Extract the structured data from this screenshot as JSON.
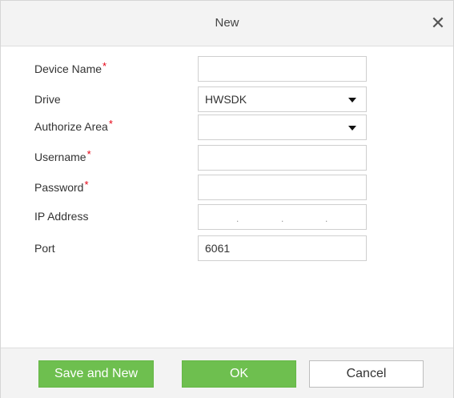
{
  "dialog": {
    "title": "New",
    "close_symbol": "✕",
    "close_icon": "close-icon"
  },
  "form": {
    "device_name": {
      "label": "Device Name",
      "required": "*",
      "value": ""
    },
    "drive": {
      "label": "Drive",
      "value": "HWSDK"
    },
    "authorize_area": {
      "label": "Authorize Area",
      "required": "*",
      "value": ""
    },
    "username": {
      "label": "Username",
      "required": "*",
      "value": ""
    },
    "password": {
      "label": "Password",
      "required": "*",
      "value": ""
    },
    "ip_address": {
      "label": "IP Address",
      "dot": "."
    },
    "port": {
      "label": "Port",
      "value": "6061"
    }
  },
  "buttons": {
    "save_and_new": "Save and New",
    "ok": "OK",
    "cancel": "Cancel"
  },
  "colors": {
    "primary_green": "#6ebf4f",
    "required_red": "#e60012"
  }
}
